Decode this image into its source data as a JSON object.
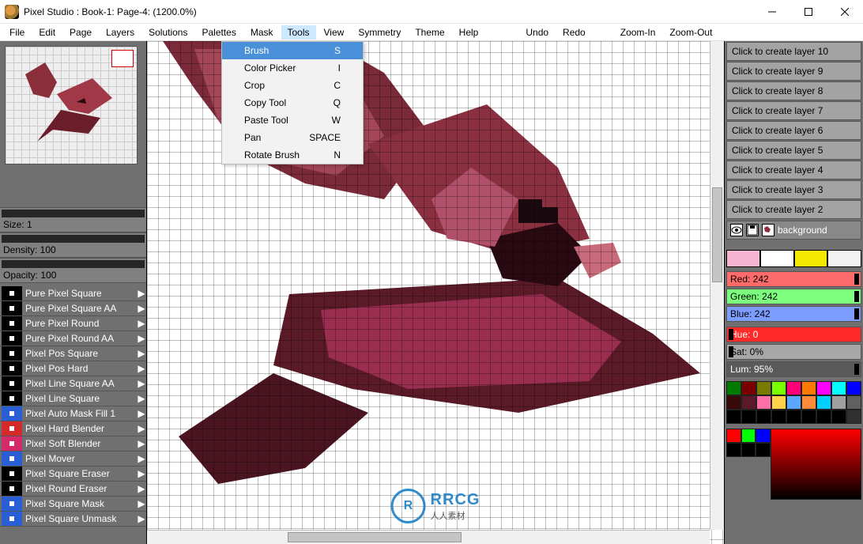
{
  "window": {
    "title": "Pixel Studio : Book-1: Page-4: (1200.0%)"
  },
  "menu": {
    "items": [
      "File",
      "Edit",
      "Page",
      "Layers",
      "Solutions",
      "Palettes",
      "Mask",
      "Tools",
      "View",
      "Symmetry",
      "Theme",
      "Help"
    ],
    "actions": [
      "Undo",
      "Redo",
      "Zoom-In",
      "Zoom-Out"
    ],
    "active_index": 7
  },
  "tools_menu": {
    "items": [
      {
        "label": "Brush",
        "shortcut": "S",
        "highlight": true
      },
      {
        "label": "Color Picker",
        "shortcut": "I"
      },
      {
        "label": "Crop",
        "shortcut": "C"
      },
      {
        "label": "Copy Tool",
        "shortcut": "Q"
      },
      {
        "label": "Paste Tool",
        "shortcut": "W"
      },
      {
        "label": "Pan",
        "shortcut": "SPACE"
      },
      {
        "label": "Rotate Brush",
        "shortcut": "N"
      }
    ]
  },
  "left": {
    "size_label": "Size: 1",
    "density_label": "Density: 100",
    "opacity_label": "Opacity: 100",
    "brushes": [
      "Pure Pixel Square",
      "Pure Pixel Square AA",
      "Pure Pixel Round",
      "Pure Pixel Round AA",
      "Pixel Pos Square",
      "Pixel Pos Hard",
      "Pixel Line Square AA",
      "Pixel Line Square",
      "Pixel Auto Mask Fill 1",
      "Pixel Hard Blender",
      "Pixel Soft Blender",
      "Pixel Mover",
      "Pixel Square Eraser",
      "Pixel Round Eraser",
      "Pixel Square Mask",
      "Pixel Square Unmask"
    ],
    "brush_icon_colors": [
      "#000000",
      "#000000",
      "#000000",
      "#000000",
      "#000000",
      "#000000",
      "#000000",
      "#000000",
      "#2a5ed4",
      "#d42a2a",
      "#d42a6a",
      "#2a5ed4",
      "#000000",
      "#000000",
      "#2a5ed4",
      "#2a5ed4"
    ]
  },
  "right": {
    "layer_buttons": [
      "Click to create layer 10",
      "Click to create layer 9",
      "Click to create layer 8",
      "Click to create layer 7",
      "Click to create layer 6",
      "Click to create layer 5",
      "Click to create layer 4",
      "Click to create layer 3",
      "Click to create layer 2"
    ],
    "active_layer": "background",
    "swatches": [
      "#f6b6d1",
      "#ffffff",
      "#f4e900",
      "#f2f2f2"
    ],
    "rgb": {
      "red": "Red: 242",
      "green": "Green: 242",
      "blue": "Blue: 242"
    },
    "hsl": {
      "hue": "Hue: 0",
      "sat": "Sat: 0%",
      "lum": "Lum: 95%"
    },
    "rgb_bg": {
      "red": "#ff6b6b",
      "green": "#7cff7c",
      "blue": "#7c9dff"
    },
    "hsl_bg": {
      "hue": "#ff2a2a",
      "sat": "#a7a7a7",
      "lum": "#5a5a5a"
    },
    "palette": [
      "#007a00",
      "#7a0000",
      "#7a7a00",
      "#7aff00",
      "#ff007a",
      "#ff7a00",
      "#ff00ff",
      "#00ffff",
      "#0000ff",
      "#3a0a0a",
      "#5a1a2a",
      "#ff6fa8",
      "#ffd24a",
      "#5aa8ff",
      "#ff8a3a",
      "#00d0ff",
      "#a0a0a0",
      "#606060",
      "#000000",
      "#000000",
      "#000000",
      "#000000",
      "#000000",
      "#000000",
      "#000000",
      "#000000",
      "#303030"
    ],
    "mini_palette": [
      "#ff0000",
      "#00ff00",
      "#0000ff",
      "#000000",
      "#000000",
      "#000000"
    ]
  },
  "watermark": {
    "brand": "RRCG",
    "sub": "人人素材"
  }
}
